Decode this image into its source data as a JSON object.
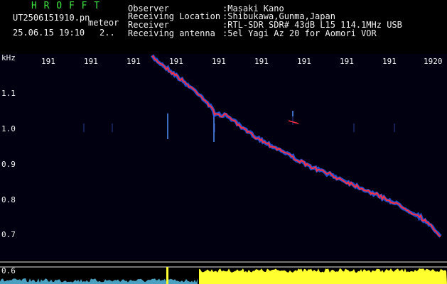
{
  "header": {
    "station_logo": "H R O F F T",
    "filename": "UT2506151910.pn",
    "tag": "meteor",
    "datetime": "25.06.15 19:10",
    "small": "2.."
  },
  "info": {
    "rows": [
      {
        "label": "Observer",
        "value": ":Masaki Kano"
      },
      {
        "label": "Receiving Location",
        "value": ":Shibukawa,Gunma,Japan"
      },
      {
        "label": "Receiver",
        "value": ":RTL-SDR SDR# 43dB L15 114.1MHz USB"
      },
      {
        "label": "Receiving antenna",
        "value": ":5el Yagi Az 20 for Aomori VOR"
      }
    ]
  },
  "axes": {
    "y_unit": "kHz",
    "y_ticks": [
      "1.1",
      "1.0",
      "0.9",
      "0.8",
      "0.7",
      "0.6"
    ],
    "x_ticks": [
      "191",
      "191",
      "191",
      "191",
      "191",
      "191",
      "191",
      "191",
      "191",
      "1920"
    ]
  },
  "colors": {
    "background": "#000010",
    "text": "#f2f2f2",
    "logo": "#3fe83f",
    "trace_core": "#ff3040",
    "trace_edge": "#2060ff",
    "level": "#ffff30"
  }
}
